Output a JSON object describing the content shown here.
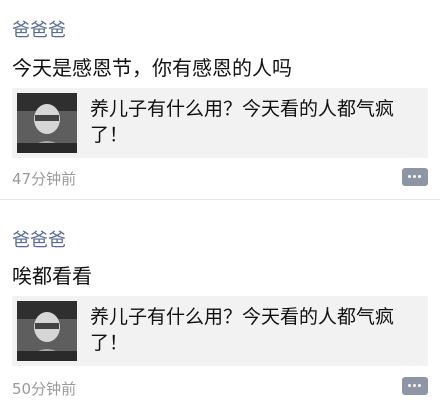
{
  "posts": [
    {
      "author": "爸爸爸",
      "text": "今天是感恩节，你有感恩的人吗",
      "card": {
        "title": "养儿子有什么用？今天看的人都气疯了！"
      },
      "time": "47分钟前"
    },
    {
      "author": "爸爸爸",
      "text": "唉都看看",
      "card": {
        "title": "养儿子有什么用？今天看的人都气疯了！"
      },
      "time": "50分钟前"
    }
  ],
  "icons": {
    "comment": "comment-bubble-icon"
  },
  "colors": {
    "author": "#576b95",
    "time": "#9a9a9a",
    "card_bg": "#f2f2f2",
    "comment_btn": "#8e96a6"
  }
}
